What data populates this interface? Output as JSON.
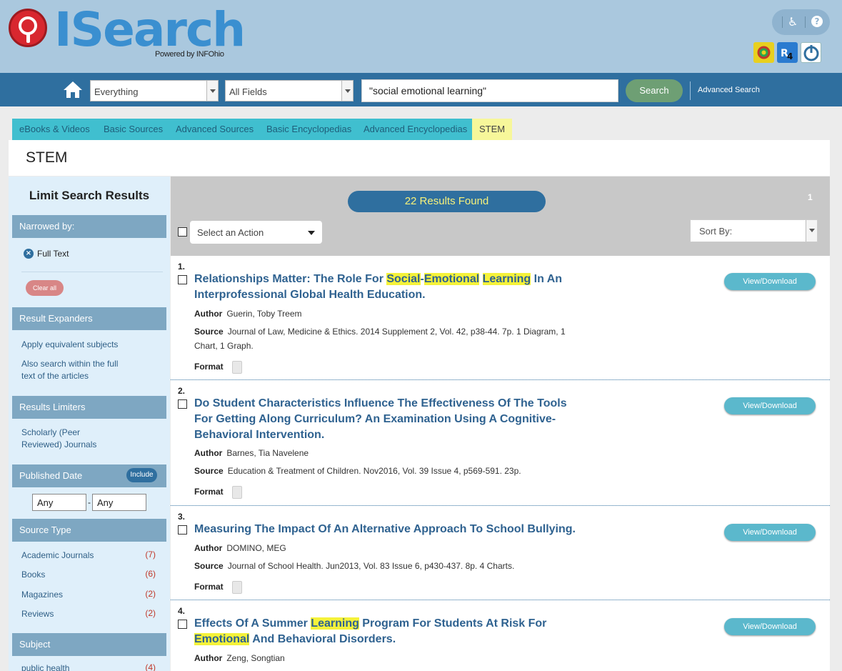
{
  "header": {
    "logo_text": "ISearch",
    "powered_by": "Powered by INFOhio"
  },
  "searchbar": {
    "scope": "Everything",
    "field": "All Fields",
    "query": "\"social emotional learning\"",
    "search_label": "Search",
    "advanced_label": "Advanced Search"
  },
  "tabs": [
    {
      "label": "eBooks & Videos"
    },
    {
      "label": "Basic Sources"
    },
    {
      "label": "Advanced Sources"
    },
    {
      "label": "Basic Encyclopedias"
    },
    {
      "label": "Advanced Encyclopedias"
    },
    {
      "label": "STEM",
      "active": true
    }
  ],
  "page_title": "STEM",
  "sidebar": {
    "title": "Limit Search Results",
    "narrowed_by": "Narrowed by:",
    "active_filter": "Full Text",
    "clear_all": "Clear all",
    "expanders_header": "Result Expanders",
    "expanders": [
      "Apply equivalent subjects",
      "Also search within the full text of the articles"
    ],
    "limiters_header": "Results Limiters",
    "limiters": [
      "Scholarly (Peer Reviewed) Journals"
    ],
    "date_header": "Published Date",
    "include_label": "Include",
    "date_from": "Any",
    "date_to": "Any",
    "date_sep": "-",
    "source_header": "Source Type",
    "sources": [
      {
        "label": "Academic Journals",
        "count": "(7)"
      },
      {
        "label": "Books",
        "count": "(6)"
      },
      {
        "label": "Magazines",
        "count": "(2)"
      },
      {
        "label": "Reviews",
        "count": "(2)"
      }
    ],
    "subject_header": "Subject",
    "subjects": [
      {
        "label": "public health",
        "count": "(4)"
      }
    ]
  },
  "results": {
    "found": "22 Results Found",
    "page": "1",
    "action_placeholder": "Select an Action",
    "sort_label": "Sort By:",
    "view_label": "View/Download",
    "author_label": "Author",
    "source_label": "Source",
    "format_label": "Format",
    "items": [
      {
        "num": "1.",
        "title_parts": [
          {
            "t": "Relationships Matter: The Role For "
          },
          {
            "t": "Social",
            "hl": true
          },
          {
            "t": "-"
          },
          {
            "t": "Emotional",
            "hl": true
          },
          {
            "t": " "
          },
          {
            "t": "Learning",
            "hl": true
          },
          {
            "t": " In An Interprofessional Global Health Education."
          }
        ],
        "author": "Guerin, Toby Treem",
        "source": "Journal of Law, Medicine & Ethics. 2014 Supplement 2, Vol. 42, p38-44. 7p. 1 Diagram, 1 Chart, 1 Graph."
      },
      {
        "num": "2.",
        "title_parts": [
          {
            "t": "Do Student Characteristics Influence The Effectiveness Of The Tools For Getting Along Curriculum? An Examination Using A Cognitive-Behavioral Intervention."
          }
        ],
        "author": "Barnes, Tia Navelene",
        "source": "Education & Treatment of Children. Nov2016, Vol. 39 Issue 4, p569-591. 23p."
      },
      {
        "num": "3.",
        "title_parts": [
          {
            "t": "Measuring The Impact Of An Alternative Approach To School Bullying."
          }
        ],
        "author": "DOMINO, MEG",
        "source": "Journal of School Health. Jun2013, Vol. 83 Issue 6, p430-437. 8p. 4 Charts."
      },
      {
        "num": "4.",
        "title_parts": [
          {
            "t": "Effects Of A Summer "
          },
          {
            "t": "Learning",
            "hl": true
          },
          {
            "t": " Program For Students At Risk For "
          },
          {
            "t": "Emotional",
            "hl": true
          },
          {
            "t": " And Behavioral Disorders."
          }
        ],
        "author": "Zeng, Songtian",
        "source": ""
      }
    ]
  },
  "colors": {
    "header_bg": "#aac8de",
    "bar_bg": "#2f6f9f",
    "tab_bg": "#40bfcf",
    "tab_active": "#f7f79a",
    "highlight": "#f5f23a",
    "search_btn": "#6e9f74"
  }
}
